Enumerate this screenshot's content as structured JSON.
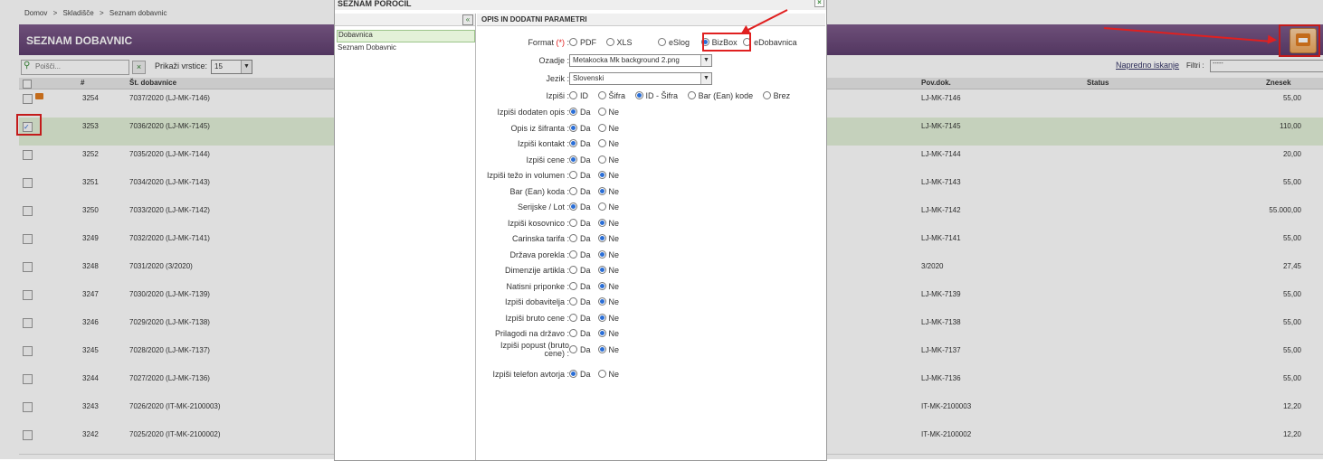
{
  "breadcrumb": {
    "home": "Domov",
    "sep": ">",
    "warehouse": "Skladišče",
    "page": "Seznam dobavnic"
  },
  "page_title": "SEZNAM DOBAVNIC",
  "search": {
    "placeholder": "Poišči..."
  },
  "rows_label": "Prikaži vrstice:",
  "rows_value": "15",
  "advanced_search": "Napredno iskanje",
  "filter_label": "Filtri :",
  "filter_value": "-----",
  "columns": {
    "id": "#",
    "doc": "Št. dobavnice",
    "pov": "Pov.dok.",
    "status": "Status",
    "amount": "Znesek"
  },
  "rows": [
    {
      "id": "3254",
      "doc": "7037/2020 (LJ-MK-7146)",
      "pov": "LJ-MK-7146",
      "amount": "55,00"
    },
    {
      "id": "3253",
      "doc": "7036/2020 (LJ-MK-7145)",
      "pov": "LJ-MK-7145",
      "amount": "110,00"
    },
    {
      "id": "3252",
      "doc": "7035/2020 (LJ-MK-7144)",
      "pov": "LJ-MK-7144",
      "amount": "20,00"
    },
    {
      "id": "3251",
      "doc": "7034/2020 (LJ-MK-7143)",
      "pov": "LJ-MK-7143",
      "amount": "55,00"
    },
    {
      "id": "3250",
      "doc": "7033/2020 (LJ-MK-7142)",
      "pov": "LJ-MK-7142",
      "amount": "55.000,00"
    },
    {
      "id": "3249",
      "doc": "7032/2020 (LJ-MK-7141)",
      "pov": "LJ-MK-7141",
      "amount": "55,00"
    },
    {
      "id": "3248",
      "doc": "7031/2020 (3/2020)",
      "pov": "3/2020",
      "amount": "27,45"
    },
    {
      "id": "3247",
      "doc": "7030/2020 (LJ-MK-7139)",
      "pov": "LJ-MK-7139",
      "amount": "55,00"
    },
    {
      "id": "3246",
      "doc": "7029/2020 (LJ-MK-7138)",
      "pov": "LJ-MK-7138",
      "amount": "55,00"
    },
    {
      "id": "3245",
      "doc": "7028/2020 (LJ-MK-7137)",
      "pov": "LJ-MK-7137",
      "amount": "55,00"
    },
    {
      "id": "3244",
      "doc": "7027/2020 (LJ-MK-7136)",
      "pov": "LJ-MK-7136",
      "amount": "55,00"
    },
    {
      "id": "3243",
      "doc": "7026/2020 (IT-MK-2100003)",
      "pov": "IT-MK-2100003",
      "amount": "12,20"
    },
    {
      "id": "3242",
      "doc": "7025/2020 (IT-MK-2100002)",
      "pov": "IT-MK-2100002",
      "amount": "12,20"
    }
  ],
  "modal": {
    "title": "SEZNAM POROČIL",
    "close": "×",
    "collapse": "«",
    "reports": [
      "Dobavnica",
      "Seznam Dobavnic"
    ],
    "params_title": "OPIS IN DODATNI PARAMETRI",
    "format": {
      "label": "Format",
      "required": "(*)",
      "colon": ":",
      "options": [
        "PDF",
        "XLS",
        "eSlog",
        "BizBox",
        "eDobavnica"
      ]
    },
    "background": {
      "label": "Ozadje :",
      "value": "Metakocka Mk background 2.png"
    },
    "language": {
      "label": "Jezik :",
      "value": "Slovenski"
    },
    "print_what": {
      "label": "Izpiši :",
      "options": [
        "ID",
        "Šifra",
        "ID - Šifra",
        "Bar (Ean) kode",
        "Brez"
      ]
    },
    "yes": "Da",
    "no": "Ne",
    "params": [
      {
        "label": "Izpiši dodaten opis :",
        "value": "Da"
      },
      {
        "label": "Opis iz šifranta :",
        "value": "Da"
      },
      {
        "label": "Izpiši kontakt :",
        "value": "Da"
      },
      {
        "label": "Izpiši cene :",
        "value": "Da"
      },
      {
        "label": "Izpiši težo in volumen :",
        "value": "Ne"
      },
      {
        "label": "Bar (Ean) koda :",
        "value": "Ne"
      },
      {
        "label": "Serijske / Lot :",
        "value": "Da"
      },
      {
        "label": "Izpiši kosovnico :",
        "value": "Ne"
      },
      {
        "label": "Carinska tarifa :",
        "value": "Ne"
      },
      {
        "label": "Država porekla :",
        "value": "Ne"
      },
      {
        "label": "Dimenzije artikla :",
        "value": "Ne"
      },
      {
        "label": "Natisni priponke :",
        "value": "Ne"
      },
      {
        "label": "Izpiši dobavitelja :",
        "value": "Ne"
      },
      {
        "label": "Izpiši bruto cene :",
        "value": "Ne"
      },
      {
        "label": "Prilagodi na državo :",
        "value": "Ne"
      },
      {
        "label_line1": "Izpiši popust (bruto",
        "label_line2": "cene) :",
        "value": "Ne"
      },
      {
        "label": "Izpiši telefon avtorja :",
        "value": "Da"
      }
    ]
  },
  "colors": {
    "header": "#6b4a7b",
    "selected_row": "#e3f1d8",
    "annotation": "#e02020",
    "radio": "#2a6ed6"
  }
}
